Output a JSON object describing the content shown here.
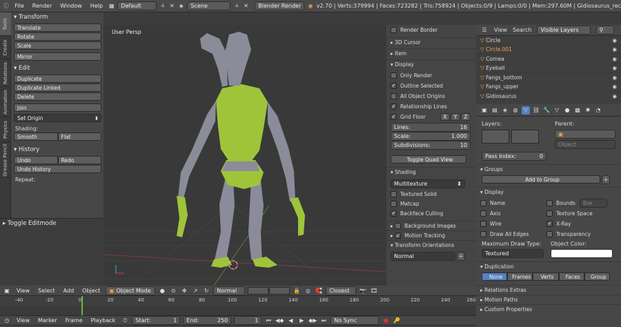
{
  "topbar": {
    "menus": [
      "File",
      "Render",
      "Window",
      "Help"
    ],
    "screen": "Default",
    "scene": "Scene",
    "engine": "Blender Render",
    "stats": "v2.70 | Verts:379994 | Faces:723282 | Tris:758924 | Objects:0/9 | Lamps:0/0 | Mem:297.60M | Gidiosaurus_rec"
  },
  "tabs": [
    "Tools",
    "Create",
    "Relations",
    "Animation",
    "Physics",
    "Grease Pencil"
  ],
  "toolshelf": {
    "transform": {
      "title": "Transform",
      "buttons": [
        "Translate",
        "Rotate",
        "Scale",
        "Mirror"
      ]
    },
    "edit": {
      "title": "Edit",
      "buttons": [
        "Duplicate",
        "Duplicate Linked",
        "Delete",
        "Join"
      ],
      "set_origin": "Set Origin",
      "shading_label": "Shading:",
      "smooth": "Smooth",
      "flat": "Flat"
    },
    "history": {
      "title": "History",
      "undo": "Undo",
      "redo": "Redo",
      "undo_history": "Undo History",
      "repeat": "Repeat:"
    },
    "toggle_editmode": "Toggle Editmode"
  },
  "viewport": {
    "label": "User Persp"
  },
  "npanel": {
    "render_border": "Render Border",
    "cursor": "3D Cursor",
    "item": "Item",
    "display": "Display",
    "only_render": "Only Render",
    "outline_selected": "Outline Selected",
    "all_object_origins": "All Object Origins",
    "relationship_lines": "Relationship Lines",
    "grid_floor": "Grid Floor",
    "axes": [
      "X",
      "Y",
      "Z"
    ],
    "lines_label": "Lines:",
    "lines_val": "16",
    "scale_label": "Scale:",
    "scale_val": "1.000",
    "subdiv_label": "Subdivisions:",
    "subdiv_val": "10",
    "toggle_quad": "Toggle Quad View",
    "shading": "Shading",
    "shading_mode": "Multitexture",
    "textured_solid": "Textured Solid",
    "matcap": "Matcap",
    "backface": "Backface Culling",
    "bg_images": "Background Images",
    "motion_tracking": "Motion Tracking",
    "transform_orient": "Transform Orientations",
    "orient_val": "Normal"
  },
  "outliner": {
    "view": "View",
    "search": "Search",
    "filter": "Visible Layers",
    "items": [
      "Circle",
      "Circle.001",
      "Cornea",
      "Eyeball",
      "Fangs_bottom",
      "Fangs_upper",
      "Gidiosaurus"
    ]
  },
  "props": {
    "layers": "Layers:",
    "parent": "Parent:",
    "object_ph": "Object",
    "pass_label": "Pass Index:",
    "pass_val": "0",
    "groups": "Groups",
    "add_group": "Add to Group",
    "display": "Display",
    "name": "Name",
    "bounds": "Bounds",
    "box": "Box",
    "axis": "Axis",
    "tex_space": "Texture Space",
    "wire": "Wire",
    "xray": "X-Ray",
    "draw_edges": "Draw All Edges",
    "transparency": "Transparency",
    "max_draw": "Maximum Draw Type:",
    "obj_color": "Object Color:",
    "textured": "Textured",
    "duplication": "Duplication",
    "dup_opts": [
      "None",
      "Frames",
      "Verts",
      "Faces",
      "Group"
    ],
    "relations_extras": "Relations Extras",
    "motion_paths": "Motion Paths",
    "custom_props": "Custom Properties"
  },
  "viewheader": {
    "menus": [
      "View",
      "Select",
      "Add",
      "Object"
    ],
    "mode": "Object Mode",
    "pivot": "Normal",
    "snap": "Closest"
  },
  "timeline": {
    "ticks": [
      "-40",
      "-20",
      "0",
      "20",
      "40",
      "60",
      "80",
      "100",
      "120",
      "140",
      "160",
      "180",
      "200",
      "220",
      "240",
      "260"
    ],
    "menus": [
      "View",
      "Marker",
      "Frame",
      "Playback"
    ],
    "start_label": "Start:",
    "start": "1",
    "end_label": "End:",
    "end": "250",
    "current": "1",
    "sync": "No Sync"
  },
  "colors": {
    "accent": "#5680c2",
    "mesh_green": "#9fc43a",
    "mesh_gray": "#8a8c9a"
  }
}
